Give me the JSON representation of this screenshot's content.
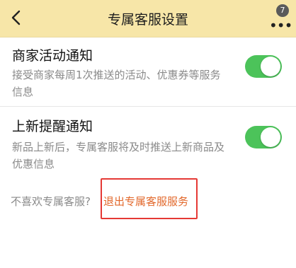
{
  "header": {
    "title": "专属客服设置",
    "back_icon": "chevron-left-icon",
    "more_icon": "more-dots-icon",
    "badge_count": "7",
    "background": "#f7e6a8"
  },
  "settings": [
    {
      "title": "商家活动通知",
      "description": "接受商家每周1次推送的活动、优惠券等服务信息",
      "enabled": true
    },
    {
      "title": "上新提醒通知",
      "description": "新品上新后，专属客服将及时推送上新商品及优惠信息",
      "enabled": true
    }
  ],
  "footer": {
    "question": "不喜欢专属客服?",
    "exit_link": "退出专属客服服务",
    "link_color": "#e2672a",
    "highlight_color": "#e53935"
  },
  "colors": {
    "toggle_on": "#4cc35a"
  }
}
